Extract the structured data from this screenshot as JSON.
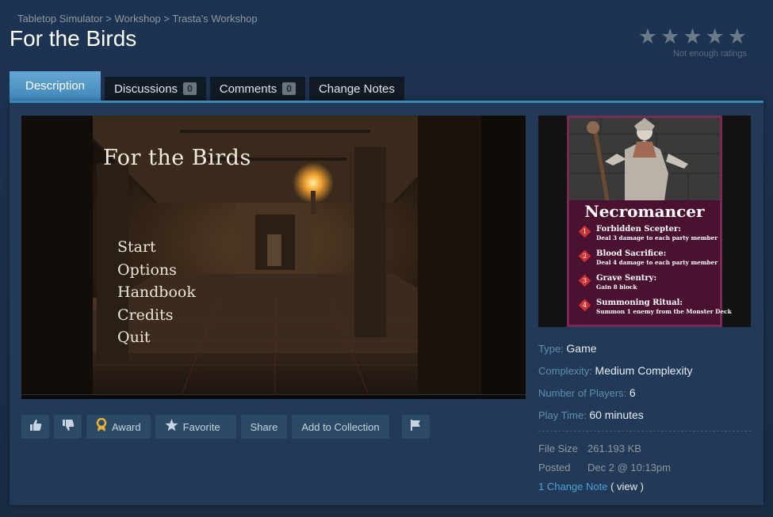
{
  "breadcrumb": [
    {
      "label": "Tabletop Simulator"
    },
    {
      "label": "Workshop"
    },
    {
      "label": "Trasta's Workshop"
    }
  ],
  "breadcrumb_separator": " > ",
  "title": "For the Birds",
  "rating": {
    "stars": [
      "★",
      "★",
      "★",
      "★",
      "★"
    ],
    "note": "Not enough ratings"
  },
  "tabs": [
    {
      "label": "Description",
      "active": true
    },
    {
      "label": "Discussions",
      "count": "0"
    },
    {
      "label": "Comments",
      "count": "0"
    },
    {
      "label": "Change Notes"
    }
  ],
  "screenshot": {
    "game_title": "For the Birds",
    "menu": [
      "Start",
      "Options",
      "Handbook",
      "Credits",
      "Quit"
    ]
  },
  "actions": {
    "award_label": "Award",
    "favorite_label": "Favorite",
    "share_label": "Share",
    "collection_label": "Add to Collection"
  },
  "card": {
    "name": "Necromancer",
    "abilities": [
      {
        "num": "1",
        "name": "Forbidden Scepter:",
        "desc": "Deal 3 damage to each party member"
      },
      {
        "num": "2",
        "name": "Blood Sacrifice:",
        "desc": "Deal 4 damage to each party member"
      },
      {
        "num": "3",
        "name": "Grave Sentry:",
        "desc": "Gain 8 block"
      },
      {
        "num": "4",
        "name": "Summoning Ritual:",
        "desc": "Summon 1 enemy from the Monster Deck"
      }
    ]
  },
  "details": {
    "type_label": "Type:",
    "type_value": "Game",
    "complexity_label": "Complexity:",
    "complexity_value": "Medium Complexity",
    "players_label": "Number of Players:",
    "players_value": "6",
    "playtime_label": "Play Time:",
    "playtime_value": "60 minutes",
    "filesize_label": "File Size",
    "filesize_value": "261.193 KB",
    "posted_label": "Posted",
    "posted_value": "Dec 2 @ 10:13pm",
    "change_note_link": "1 Change Note",
    "view_link": "( view )"
  },
  "colors": {
    "accent": "#3f86b8",
    "link": "#4aa2d8",
    "background": "#1b2f4a",
    "panel": "#223a57"
  }
}
